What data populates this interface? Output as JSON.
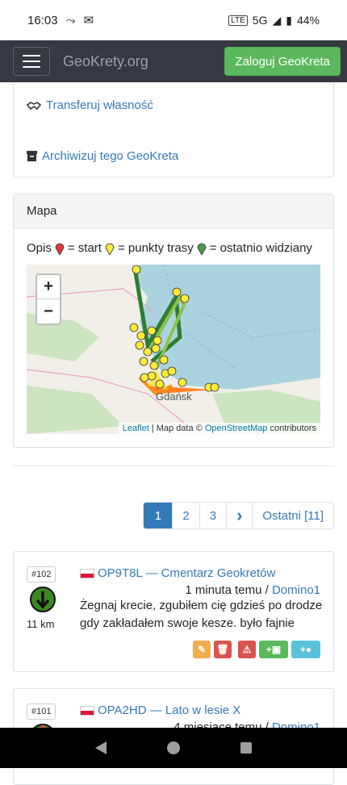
{
  "status": {
    "time": "16:03",
    "network": "5G",
    "battery": "44%"
  },
  "nav": {
    "brand": "GeoKrety.org",
    "login": "Zaloguj GeoKreta"
  },
  "actions": {
    "transfer": "Transferuj własność",
    "archive": "Archiwizuj tego GeoKreta"
  },
  "map": {
    "header": "Mapa",
    "legend_prefix": "Opis",
    "legend_start": "= start",
    "legend_trasa": "= punkty trasy",
    "legend_last": "= ostatnio widziany",
    "zoom_in": "+",
    "zoom_out": "−",
    "attr_leaflet": "Leaflet",
    "attr_mid": " | Map data © ",
    "attr_osm": "OpenStreetMap",
    "attr_end": " contributors",
    "city": "Gdańsk"
  },
  "pagination": {
    "pages": [
      "1",
      "2",
      "3"
    ],
    "next": "›",
    "last": "Ostatni [11]"
  },
  "logs": [
    {
      "badge": "#102",
      "distance": "11 km",
      "title": "OP9T8L — Cmentarz Geokretów",
      "time": "1 minuta temu / ",
      "user": "Domino1",
      "text": "Żegnaj krecie, zgubiłem cię gdzieś po drodze gdy zakładałem swoje kesze. było fajnie"
    },
    {
      "badge": "#101",
      "title": "OPA2HD — Lato w lesie X",
      "time": "4 miesiące temu / ",
      "user": "Domino1"
    }
  ],
  "colors": {
    "primary": "#337ab7",
    "success": "#5cb85c",
    "navbar": "#343a40"
  }
}
